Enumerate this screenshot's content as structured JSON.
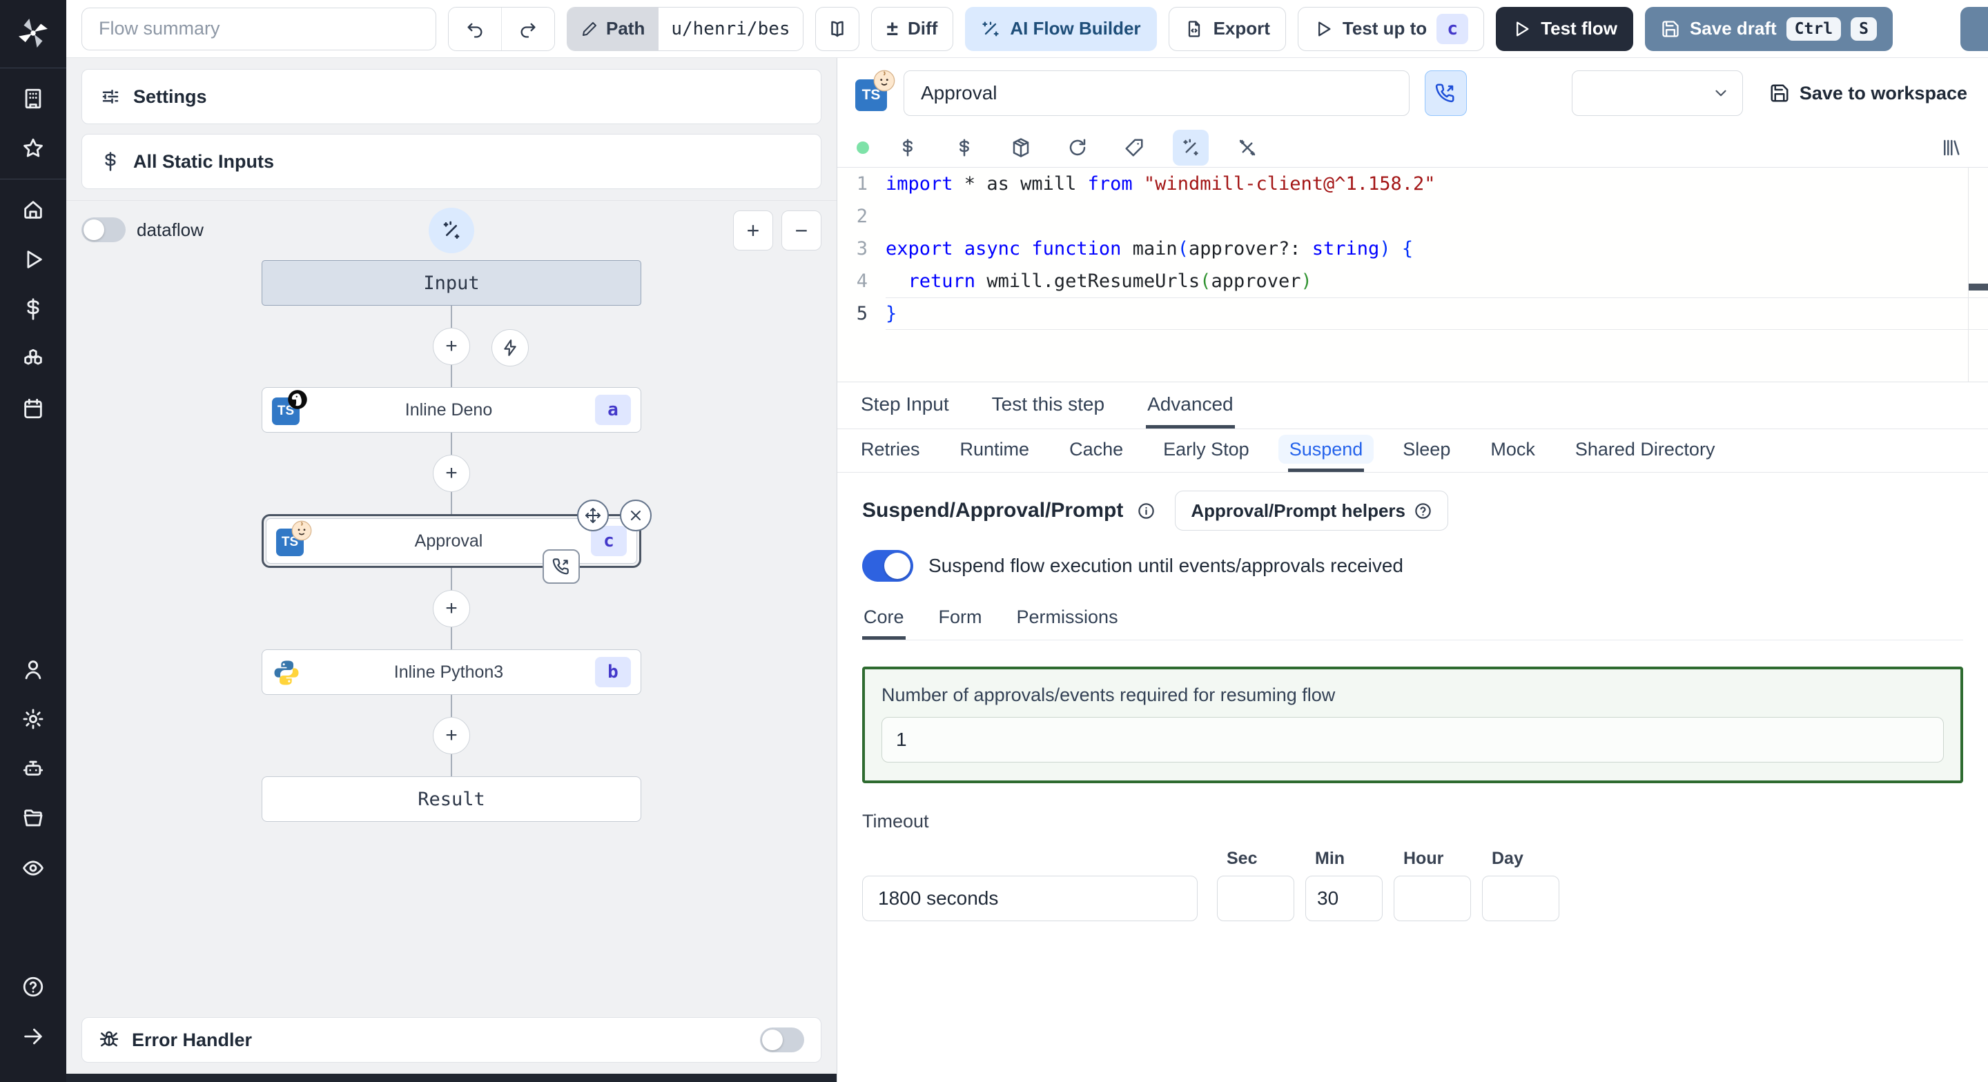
{
  "icons": {
    "plus": "+",
    "minus": "−",
    "plus_minus": "±",
    "dollar": "$"
  },
  "topbar": {
    "flow_summary_placeholder": "Flow summary",
    "path_label": "Path",
    "path_value": "u/henri/bes",
    "diff_label": "Diff",
    "ai_flow_builder_label": "AI Flow Builder",
    "export_label": "Export",
    "test_up_to_label": "Test up to",
    "test_up_to_badge": "c",
    "test_flow_label": "Test flow",
    "save_draft_label": "Save draft",
    "kbd_ctrl": "Ctrl",
    "kbd_s": "S"
  },
  "flow_panel": {
    "settings_label": "Settings",
    "all_static_inputs_label": "All Static Inputs",
    "dataflow_label": "dataflow",
    "input_node_label": "Input",
    "result_node_label": "Result",
    "nodes": [
      {
        "label": "Inline Deno",
        "badge": "a"
      },
      {
        "label": "Approval",
        "badge": "c"
      },
      {
        "label": "Inline Python3",
        "badge": "b"
      }
    ],
    "error_handler_label": "Error Handler"
  },
  "step_panel": {
    "name_value": "Approval",
    "save_to_workspace_label": "Save to workspace",
    "tabs": [
      "Step Input",
      "Test this step",
      "Advanced"
    ],
    "active_tab": "Advanced",
    "subtabs": [
      "Retries",
      "Runtime",
      "Cache",
      "Early Stop",
      "Suspend",
      "Sleep",
      "Mock",
      "Shared Directory"
    ],
    "active_subtab": "Suspend",
    "editor": {
      "lines": [
        {
          "n": "1",
          "segs": [
            [
              "import",
              "kw"
            ],
            [
              " * as wmill ",
              "tx"
            ],
            [
              "from",
              "kw"
            ],
            [
              " ",
              "tx"
            ],
            [
              "\"windmill-client@^1.158.2\"",
              "str"
            ]
          ]
        },
        {
          "n": "2",
          "segs": []
        },
        {
          "n": "3",
          "segs": [
            [
              "export",
              "kw"
            ],
            [
              " ",
              "tx"
            ],
            [
              "async",
              "kw"
            ],
            [
              " ",
              "tx"
            ],
            [
              "function",
              "kw"
            ],
            [
              " main",
              "tx"
            ],
            [
              "(",
              "b1"
            ],
            [
              "approver?: ",
              "tx"
            ],
            [
              "string",
              "kw"
            ],
            [
              ")",
              "b1"
            ],
            [
              " {",
              "b1"
            ]
          ]
        },
        {
          "n": "4",
          "segs": [
            [
              "  ",
              "tx"
            ],
            [
              "return",
              "kw"
            ],
            [
              " wmill.getResumeUrls",
              "tx"
            ],
            [
              "(",
              "b2"
            ],
            [
              "approver",
              "tx"
            ],
            [
              ")",
              "b2"
            ]
          ]
        },
        {
          "n": "5",
          "segs": [
            [
              "}",
              "b1"
            ]
          ],
          "current": true
        }
      ]
    },
    "suspend": {
      "title": "Suspend/Approval/Prompt",
      "helpers_label": "Approval/Prompt helpers",
      "toggle_label": "Suspend flow execution until events/approvals received",
      "tabs": [
        "Core",
        "Form",
        "Permissions"
      ],
      "active_tab": "Core",
      "approvals_label": "Number of approvals/events required for resuming flow",
      "approvals_value": "1",
      "timeout_label": "Timeout",
      "timeout_value": "1800 seconds",
      "units": [
        {
          "label": "Sec",
          "value": ""
        },
        {
          "label": "Min",
          "value": "30"
        },
        {
          "label": "Hour",
          "value": ""
        },
        {
          "label": "Day",
          "value": ""
        }
      ]
    }
  },
  "colors": {
    "accent": "#2563eb",
    "sidebar_bg": "#1b1e27",
    "panel_bg": "#f0f1f3",
    "test_flow_bg": "#242b39",
    "save_draft_bg": "#6684a3",
    "badge_bg": "#e0e7ff",
    "badge_text": "#4338ca",
    "ai_builder_bg": "#dbeafe",
    "ai_builder_text": "#1e4e79",
    "suspend_box_border": "#2e6b30",
    "code_keyword": "#0000ff",
    "code_string": "#a31515"
  }
}
